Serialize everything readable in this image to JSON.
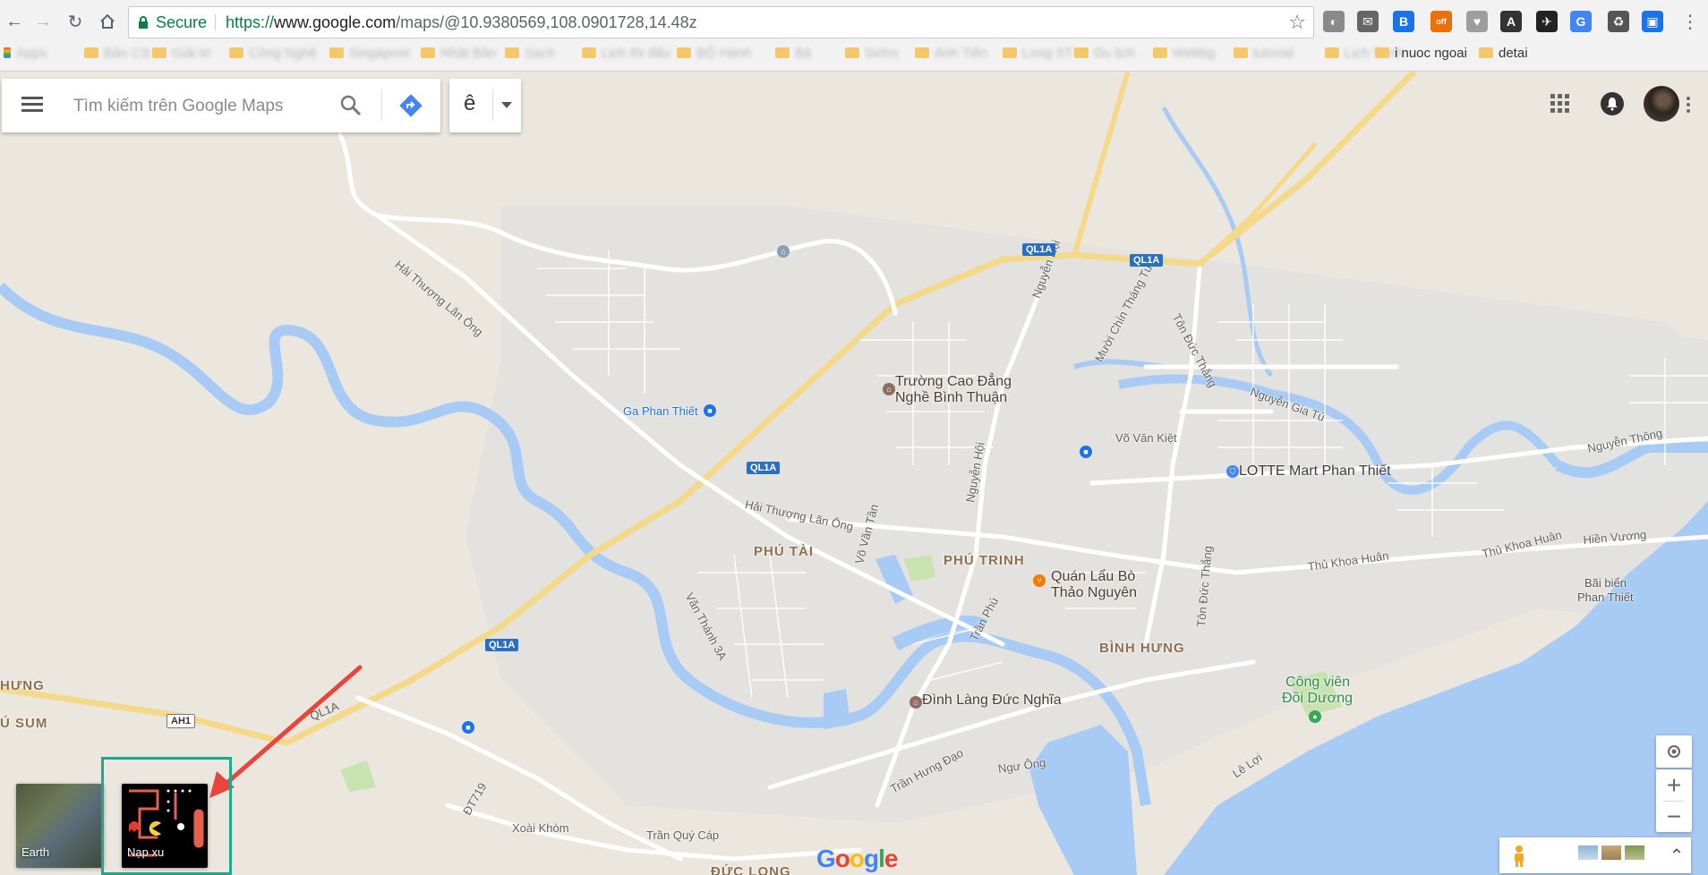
{
  "browser": {
    "secure_label": "Secure",
    "url_scheme": "https://",
    "url_host": "www.google.com",
    "url_path": "/maps/@10.9380569,108.0901728,14.48z",
    "bookmarks": [
      {
        "label": "Apps"
      },
      {
        "label": "Bảo CS"
      },
      {
        "label": "Giải tri"
      },
      {
        "label": "Công Nghệ"
      },
      {
        "label": "Singapore"
      },
      {
        "label": "Nhật Bản"
      },
      {
        "label": "Sach"
      },
      {
        "label": "Lịch thi đấu"
      },
      {
        "label": "BỘ Hành"
      },
      {
        "label": "Bà"
      },
      {
        "label": "Sinhs"
      },
      {
        "label": "Anh Tiến"
      },
      {
        "label": "Long ST"
      },
      {
        "label": "Du lịch"
      },
      {
        "label": "Webbg"
      },
      {
        "label": "tutorial"
      },
      {
        "label": "Lịch Trình"
      },
      {
        "label": "i nuoc ngoai"
      },
      {
        "label": "detai"
      }
    ],
    "extensions": [
      {
        "icon": "cloud-extension-icon",
        "color": "#8a8a8a",
        "glyph": "◐"
      },
      {
        "icon": "mail-extension-icon",
        "color": "#666666",
        "glyph": "✉"
      },
      {
        "icon": "blue-extension-icon",
        "color": "#1a73e8",
        "glyph": "B"
      },
      {
        "icon": "adblock-extension-icon",
        "color": "#e8710a",
        "glyph": "off"
      },
      {
        "icon": "heart-extension-icon",
        "color": "#9e9e9e",
        "glyph": "♥"
      },
      {
        "icon": "triangle-extension-icon",
        "color": "#333333",
        "glyph": "A"
      },
      {
        "icon": "bird-extension-icon",
        "color": "#222222",
        "glyph": "✈"
      },
      {
        "icon": "translate-extension-icon",
        "color": "#4285f4",
        "glyph": "G"
      },
      {
        "icon": "recycle-extension-icon",
        "color": "#555555",
        "glyph": "♻"
      },
      {
        "icon": "cast-extension-icon",
        "color": "#1a73e8",
        "glyph": "▣"
      }
    ]
  },
  "maps": {
    "search_placeholder": "Tìm kiếm trên Google Maps",
    "ime_letter": "ê",
    "satellite_tile_label": "Earth",
    "game_tile_label": "Nạp xu",
    "logo_text": "Google",
    "map_labels": {
      "hai_thuong_lan_ong_1": "Hải Thượng Lãn Ông",
      "hai_thuong_lan_ong_2": "Hải Thượng Lãn Ông",
      "ql1a": "QL1A",
      "ga_phan_thiet": "Ga Phan Thiết",
      "truong_cd_1": "Trường Cao Đẳng",
      "truong_cd_2": "Nghề Bình Thuận",
      "nguyen_hoi_1": "Nguyễn Hội",
      "nguyen_hoi_2": "Nguyễn Hội",
      "muoi_chin_thang_tu": "Mười Chín Tháng Tư",
      "ton_duc_thang_1": "Tôn Đức Thắng",
      "ton_duc_thang_2": "Tôn Đức Thắng",
      "nguyen_gia_tu": "Nguyễn Gia Tú",
      "vo_van_kiet": "Võ Văn Kiệt",
      "lotte": "LOTTE Mart Phan Thiết",
      "nguyen_thong": "Nguyễn Thông",
      "phu_tai": "PHÚ TÀI",
      "phu_trinh": "PHÚ TRINH",
      "quan_lau_1": "Quán Lẩu Bò",
      "quan_lau_2": "Thảo Nguyên",
      "thu_khoa_huan_1": "Thủ Khoa Huân",
      "thu_khoa_huan_2": "Thủ Khoa Huân",
      "hien_vuong": "Hiền Vương",
      "bai_bien_1": "Bãi biển",
      "bai_bien_2": "Phan Thiết",
      "van_thanh": "Văn Thánh 3A",
      "vo_van_tan": "Võ Văn Tần",
      "tran_phu": "Trần Phú",
      "binh_hung": "BÌNH HƯNG",
      "cong_vien_1": "Công viên",
      "cong_vien_2": "Đồi Dương",
      "dinh_lang": "Đình Làng Đức Nghĩa",
      "tran_hung_dao": "Trần Hưng Đạo",
      "ngu_ong": "Ngư Ông",
      "le_loi": "Lê Lợi",
      "hung": "HƯNG",
      "u_sum": "Ú SUM",
      "ah1": "AH1",
      "dt719": "ĐT719",
      "xoai_khom": "Xoài Khòm",
      "tran_quy_cap": "Trần Quý Cáp",
      "duc_long": "ĐỨC LONG"
    }
  }
}
